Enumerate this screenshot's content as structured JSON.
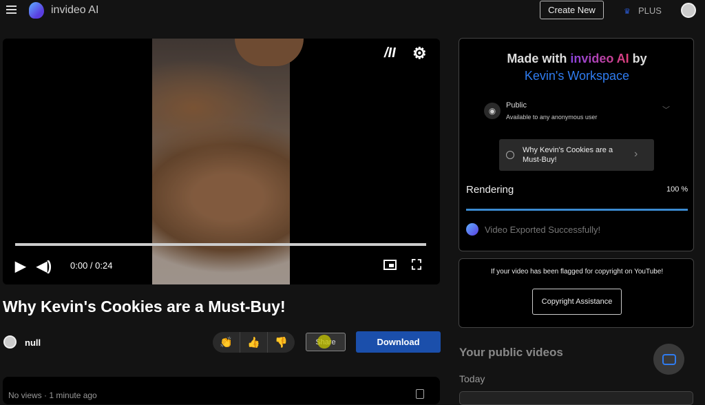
{
  "header": {
    "brand": "invideo AI",
    "create_new": "Create New",
    "plan": "PLUS"
  },
  "player": {
    "time": "0:00 / 0:24",
    "progress_percent": 0
  },
  "video": {
    "title": "Why Kevin's Cookies are a Must-Buy!",
    "user": "null",
    "share": "Share",
    "download": "Download",
    "meta": "No views · 1 minute ago"
  },
  "panel": {
    "made_prefix": "Made with ",
    "made_brand": "invideo AI",
    "made_by": " by",
    "workspace": "Kevin's Workspace",
    "visibility": "Public",
    "visibility_desc": "Available to any anonymous user",
    "video_link": "Why Kevin's Cookies are a Must-Buy!",
    "rendering": "Rendering",
    "rendering_pct": "100 %",
    "rendering_value": 100,
    "exported": "Video Exported Successfully!"
  },
  "copyright": {
    "text": "If your video has been flagged for copyright on YouTube!",
    "button": "Copyright Assistance"
  },
  "public_videos": {
    "title": "Your public videos",
    "group": "Today"
  },
  "colors": {
    "accent": "#1b4fab",
    "workspace": "#2f7cf0",
    "progress": "#3b8ad0"
  }
}
